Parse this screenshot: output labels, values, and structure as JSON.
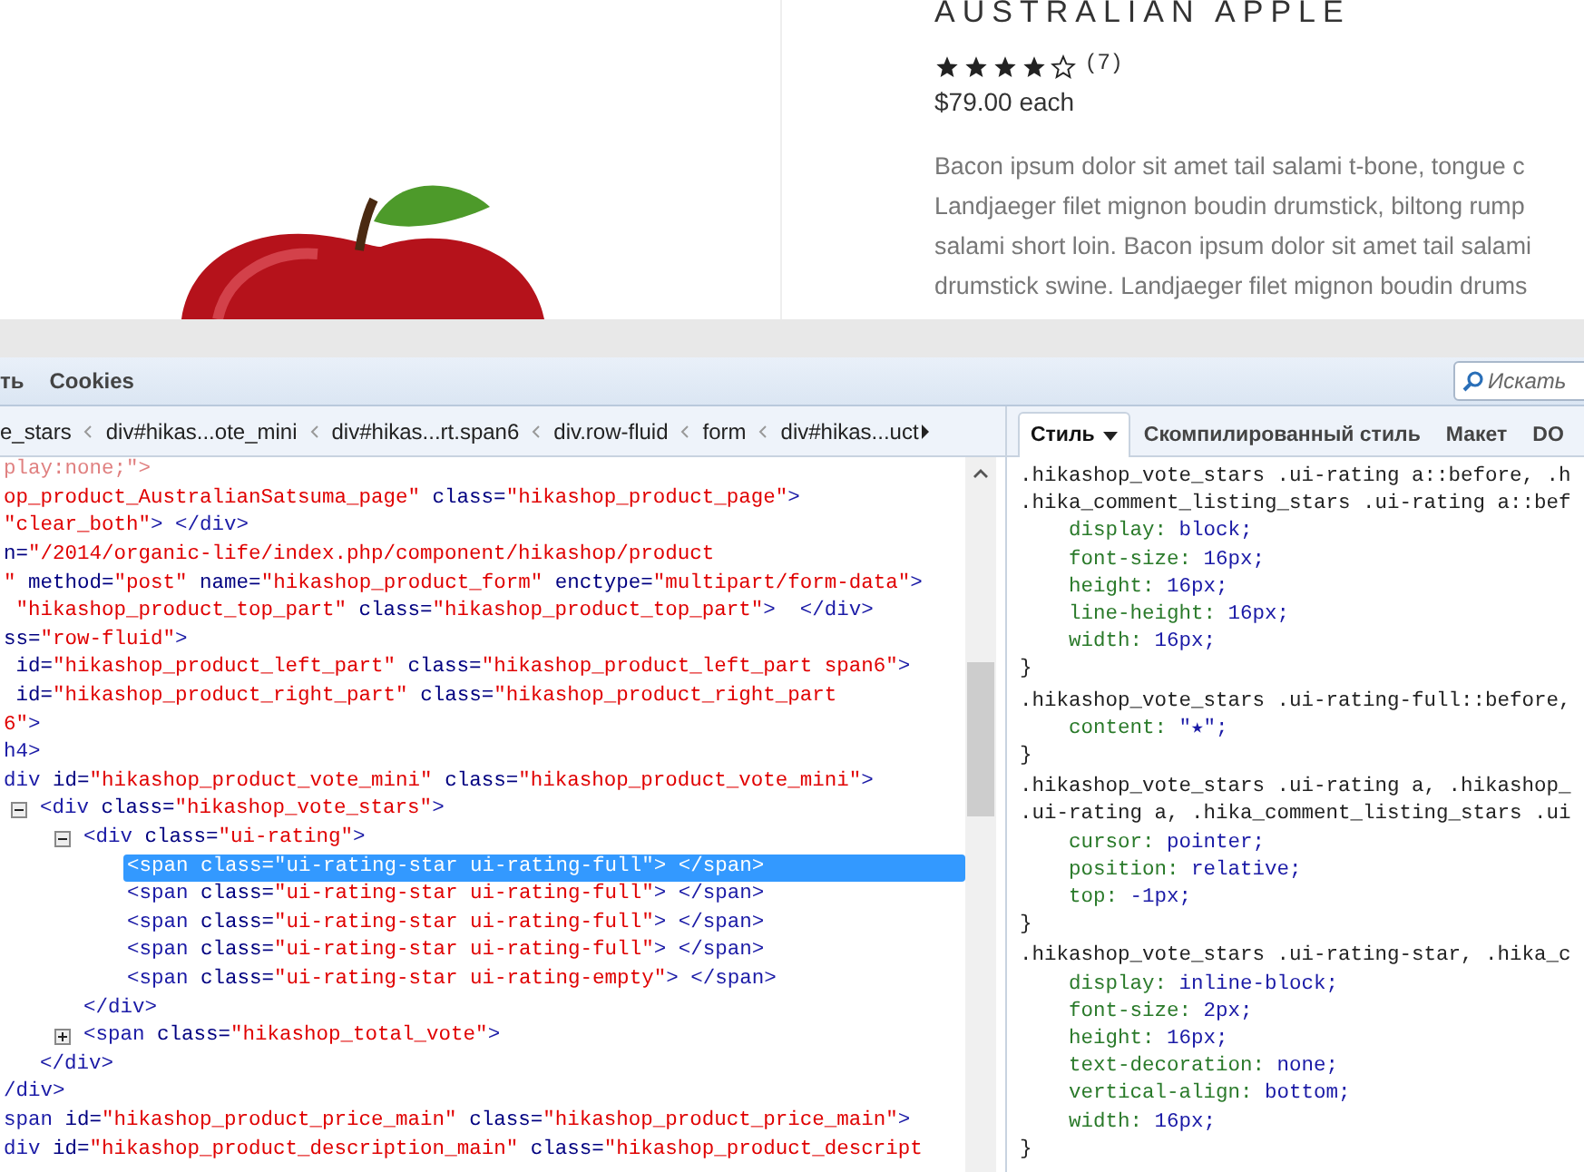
{
  "product": {
    "title": "AUSTRALIAN APPLE",
    "stars": 4,
    "vote_count": "(7)",
    "price": "$79.00 each",
    "description_lines": [
      "Bacon ipsum dolor sit amet tail salami t-bone, tongue c",
      "Landjaeger filet mignon boudin drumstick, biltong rump",
      "salami short loin. Bacon ipsum dolor sit amet tail salami",
      "drumstick swine. Landjaeger filet mignon boudin drums"
    ]
  },
  "devtools": {
    "menu": [
      {
        "label": "ть",
        "selected": false
      },
      {
        "label": "Cookies",
        "selected": false
      }
    ],
    "search": {
      "placeholder": "Искать"
    },
    "breadcrumb": [
      "e_stars",
      "div#hikas...ote_mini",
      "div#hikas...rt.span6",
      "div.row-fluid",
      "form",
      "div#hikas...uct"
    ],
    "tabs": [
      {
        "label": "Стиль",
        "selected": true
      },
      {
        "label": "Скомпилированный стиль",
        "selected": false
      },
      {
        "label": "Макет",
        "selected": false
      },
      {
        "label": "DO",
        "selected": false
      }
    ],
    "tree": [
      {
        "selected": false,
        "open": [
          {
            "kind": "faded",
            "text": "play:none;\">"
          }
        ]
      },
      {
        "selected": false,
        "open": [
          {
            "kind": "value",
            "text": "op_product_AustralianSatsuma_page\""
          },
          {
            "kind": "attr",
            "text": " class="
          },
          {
            "kind": "value",
            "text": "\"hikashop_product_page\""
          },
          {
            "kind": "tag",
            "text": ">"
          }
        ]
      },
      {
        "selected": false,
        "open": [
          {
            "kind": "value",
            "text": "\"clear_both\""
          },
          {
            "kind": "tag",
            "text": "> </div>"
          }
        ]
      },
      {
        "selected": false,
        "open": [
          {
            "kind": "attr",
            "text": "n="
          },
          {
            "kind": "value",
            "text": "\"/2014/organic-life/index.php/component/hikashop/product"
          }
        ]
      },
      {
        "selected": false,
        "open": [
          {
            "kind": "value",
            "text": "\""
          },
          {
            "kind": "attr",
            "text": " method="
          },
          {
            "kind": "value",
            "text": "\"post\""
          },
          {
            "kind": "attr",
            "text": " name="
          },
          {
            "kind": "value",
            "text": "\"hikashop_product_form\""
          },
          {
            "kind": "attr",
            "text": " enctype="
          },
          {
            "kind": "value",
            "text": "\"multipart/form-data\""
          },
          {
            "kind": "tag",
            "text": ">"
          }
        ]
      },
      {
        "selected": false,
        "open": [
          {
            "kind": "value",
            "text": " \"hikashop_product_top_part\""
          },
          {
            "kind": "attr",
            "text": " class="
          },
          {
            "kind": "value",
            "text": "\"hikashop_product_top_part\""
          },
          {
            "kind": "tag",
            "text": ">  </div>"
          }
        ]
      },
      {
        "selected": false,
        "open": [
          {
            "kind": "attr",
            "text": "ss="
          },
          {
            "kind": "value",
            "text": "\"row-fluid\""
          },
          {
            "kind": "tag",
            "text": ">"
          }
        ]
      },
      {
        "selected": false,
        "open": [
          {
            "kind": "attr",
            "text": " id="
          },
          {
            "kind": "value",
            "text": "\"hikashop_product_left_part\""
          },
          {
            "kind": "attr",
            "text": " class="
          },
          {
            "kind": "value",
            "text": "\"hikashop_product_left_part span6\""
          },
          {
            "kind": "tag",
            "text": ">"
          }
        ]
      },
      {
        "selected": false,
        "open": [
          {
            "kind": "attr",
            "text": " id="
          },
          {
            "kind": "value",
            "text": "\"hikashop_product_right_part\""
          },
          {
            "kind": "attr",
            "text": " class="
          },
          {
            "kind": "value",
            "text": "\"hikashop_product_right_part"
          }
        ]
      },
      {
        "selected": false,
        "open": [
          {
            "kind": "value",
            "text": "6\""
          },
          {
            "kind": "tag",
            "text": ">"
          }
        ]
      },
      {
        "selected": false,
        "open": [
          {
            "kind": "tag",
            "text": "h4>"
          }
        ]
      },
      {
        "selected": false,
        "open": [
          {
            "kind": "tag",
            "text": "div"
          },
          {
            "kind": "attr",
            "text": " id="
          },
          {
            "kind": "value",
            "text": "\"hikashop_product_vote_mini\""
          },
          {
            "kind": "attr",
            "text": " class="
          },
          {
            "kind": "value",
            "text": "\"hikashop_product_vote_mini\""
          },
          {
            "kind": "tag",
            "text": ">"
          }
        ],
        "close": [
          {
            "kind": "tag",
            "text": "/div>"
          }
        ],
        "children": [
          {
            "selected": false,
            "expanded": true,
            "open": [
              {
                "kind": "tag",
                "text": "<div"
              },
              {
                "kind": "attr",
                "text": " class="
              },
              {
                "kind": "value",
                "text": "\"hikashop_vote_stars\""
              },
              {
                "kind": "tag",
                "text": ">"
              }
            ],
            "close": [
              {
                "kind": "tag",
                "text": "</div>"
              }
            ],
            "children": [
              {
                "selected": false,
                "expanded": true,
                "open": [
                  {
                    "kind": "tag",
                    "text": "<div"
                  },
                  {
                    "kind": "attr",
                    "text": " class="
                  },
                  {
                    "kind": "value",
                    "text": "\"ui-rating\""
                  },
                  {
                    "kind": "tag",
                    "text": ">"
                  }
                ],
                "close": [
                  {
                    "kind": "tag",
                    "text": "</div>"
                  }
                ],
                "children": [
                  {
                    "selected": true,
                    "open": [
                      {
                        "kind": "tag",
                        "text": "<span"
                      },
                      {
                        "kind": "attr",
                        "text": " class="
                      },
                      {
                        "kind": "value",
                        "text": "\"ui-rating-star ui-rating-full\""
                      },
                      {
                        "kind": "tag",
                        "text": "> </span>"
                      }
                    ]
                  },
                  {
                    "selected": false,
                    "open": [
                      {
                        "kind": "tag",
                        "text": "<span"
                      },
                      {
                        "kind": "attr",
                        "text": " class="
                      },
                      {
                        "kind": "value",
                        "text": "\"ui-rating-star ui-rating-full\""
                      },
                      {
                        "kind": "tag",
                        "text": "> </span>"
                      }
                    ]
                  },
                  {
                    "selected": false,
                    "open": [
                      {
                        "kind": "tag",
                        "text": "<span"
                      },
                      {
                        "kind": "attr",
                        "text": " class="
                      },
                      {
                        "kind": "value",
                        "text": "\"ui-rating-star ui-rating-full\""
                      },
                      {
                        "kind": "tag",
                        "text": "> </span>"
                      }
                    ]
                  },
                  {
                    "selected": false,
                    "open": [
                      {
                        "kind": "tag",
                        "text": "<span"
                      },
                      {
                        "kind": "attr",
                        "text": " class="
                      },
                      {
                        "kind": "value",
                        "text": "\"ui-rating-star ui-rating-full\""
                      },
                      {
                        "kind": "tag",
                        "text": "> </span>"
                      }
                    ]
                  },
                  {
                    "selected": false,
                    "open": [
                      {
                        "kind": "tag",
                        "text": "<span"
                      },
                      {
                        "kind": "attr",
                        "text": " class="
                      },
                      {
                        "kind": "value",
                        "text": "\"ui-rating-star ui-rating-empty\""
                      },
                      {
                        "kind": "tag",
                        "text": "> </span>"
                      }
                    ]
                  }
                ]
              },
              {
                "selected": false,
                "expanded": false,
                "open": [
                  {
                    "kind": "tag",
                    "text": "<span"
                  },
                  {
                    "kind": "attr",
                    "text": " class="
                  },
                  {
                    "kind": "value",
                    "text": "\"hikashop_total_vote\""
                  },
                  {
                    "kind": "tag",
                    "text": ">"
                  }
                ]
              }
            ]
          }
        ]
      },
      {
        "selected": false,
        "open": [
          {
            "kind": "tag",
            "text": "span"
          },
          {
            "kind": "attr",
            "text": " id="
          },
          {
            "kind": "value",
            "text": "\"hikashop_product_price_main\""
          },
          {
            "kind": "attr",
            "text": " class="
          },
          {
            "kind": "value",
            "text": "\"hikashop_product_price_main\""
          },
          {
            "kind": "tag",
            "text": ">"
          }
        ]
      },
      {
        "selected": false,
        "open": [
          {
            "kind": "tag",
            "text": "div"
          },
          {
            "kind": "attr",
            "text": " id="
          },
          {
            "kind": "value",
            "text": "\"hikashop_product_description_main\""
          },
          {
            "kind": "attr",
            "text": " class="
          },
          {
            "kind": "value",
            "text": "\"hikashop_product_descript"
          }
        ]
      }
    ],
    "rules": [
      {
        "selectors": [
          ".hikashop_vote_stars .ui-rating a::before, .h",
          ".hika_comment_listing_stars .ui-rating a::bef"
        ],
        "declarations": [
          {
            "property": "display:",
            "value": "block;"
          },
          {
            "property": "font-size:",
            "value": "16px;"
          },
          {
            "property": "height:",
            "value": "16px;"
          },
          {
            "property": "line-height:",
            "value": "16px;"
          },
          {
            "property": "width:",
            "value": "16px;"
          }
        ],
        "close": "}"
      },
      {
        "selectors": [
          ".hikashop_vote_stars .ui-rating-full::before,"
        ],
        "declarations": [
          {
            "property": "content:",
            "value": "\"★\";"
          }
        ],
        "close": "}"
      },
      {
        "selectors": [
          ".hikashop_vote_stars .ui-rating a, .hikashop_",
          ".ui-rating a, .hika_comment_listing_stars .ui"
        ],
        "declarations": [
          {
            "property": "cursor:",
            "value": "pointer;"
          },
          {
            "property": "position:",
            "value": "relative;"
          },
          {
            "property": "top:",
            "value": "-1px;"
          }
        ],
        "close": "}"
      },
      {
        "selectors": [
          ".hikashop_vote_stars .ui-rating-star, .hika_c"
        ],
        "declarations": [
          {
            "property": "display:",
            "value": "inline-block;"
          },
          {
            "property": "font-size:",
            "value": "2px;"
          },
          {
            "property": "height:",
            "value": "16px;"
          },
          {
            "property": "text-decoration:",
            "value": "none;"
          },
          {
            "property": "vertical-align:",
            "value": "bottom;"
          },
          {
            "property": "width:",
            "value": "16px;"
          }
        ],
        "close": "}"
      }
    ]
  }
}
